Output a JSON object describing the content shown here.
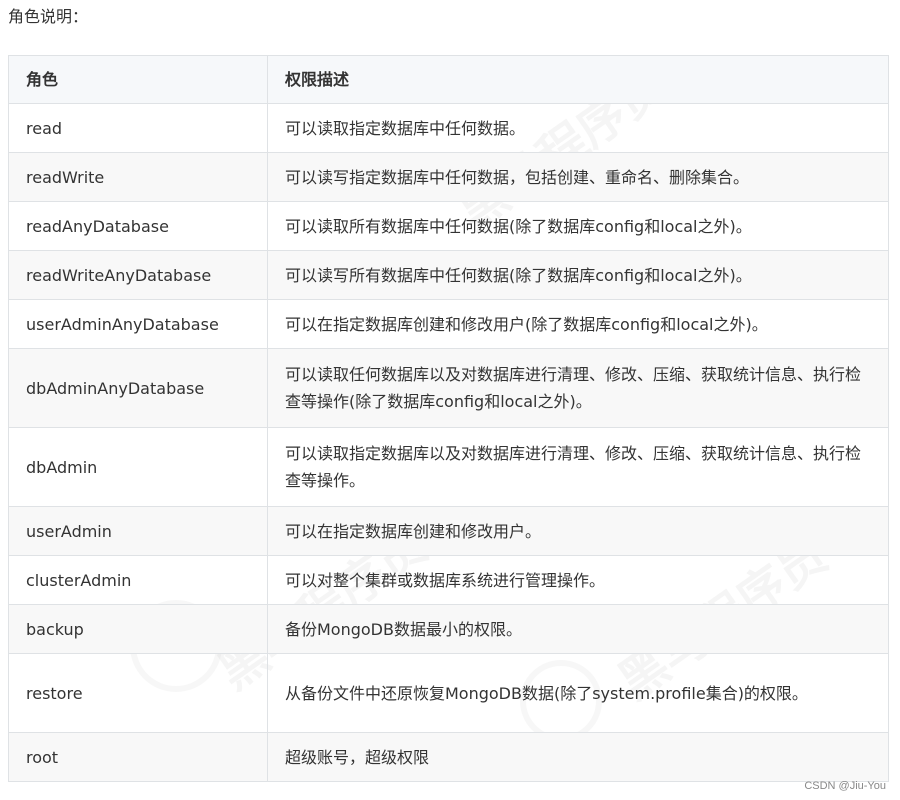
{
  "heading": "角色说明：",
  "table": {
    "headers": [
      "角色",
      "权限描述"
    ],
    "rows": [
      {
        "role": "read",
        "desc": "可以读取指定数据库中任何数据。"
      },
      {
        "role": "readWrite",
        "desc": "可以读写指定数据库中任何数据，包括创建、重命名、删除集合。"
      },
      {
        "role": "readAnyDatabase",
        "desc": "可以读取所有数据库中任何数据(除了数据库config和local之外)。"
      },
      {
        "role": "readWriteAnyDatabase",
        "desc": "可以读写所有数据库中任何数据(除了数据库config和local之外)。"
      },
      {
        "role": "userAdminAnyDatabase",
        "desc": "可以在指定数据库创建和修改用户(除了数据库config和local之外)。"
      },
      {
        "role": "dbAdminAnyDatabase",
        "desc": "可以读取任何数据库以及对数据库进行清理、修改、压缩、获取统计信息、执行检查等操作(除了数据库config和local之外)。"
      },
      {
        "role": "dbAdmin",
        "desc": "可以读取指定数据库以及对数据库进行清理、修改、压缩、获取统计信息、执行检查等操作。"
      },
      {
        "role": "userAdmin",
        "desc": "可以在指定数据库创建和修改用户。"
      },
      {
        "role": "clusterAdmin",
        "desc": "可以对整个集群或数据库系统进行管理操作。"
      },
      {
        "role": "backup",
        "desc": "备份MongoDB数据最小的权限。"
      },
      {
        "role": "restore",
        "desc": "从备份文件中还原恢复MongoDB数据(除了system.profile集合)的权限。"
      },
      {
        "role": "root",
        "desc": "超级账号，超级权限"
      }
    ]
  },
  "watermark": "黑马程序员",
  "credit": "CSDN @Jiu-You"
}
